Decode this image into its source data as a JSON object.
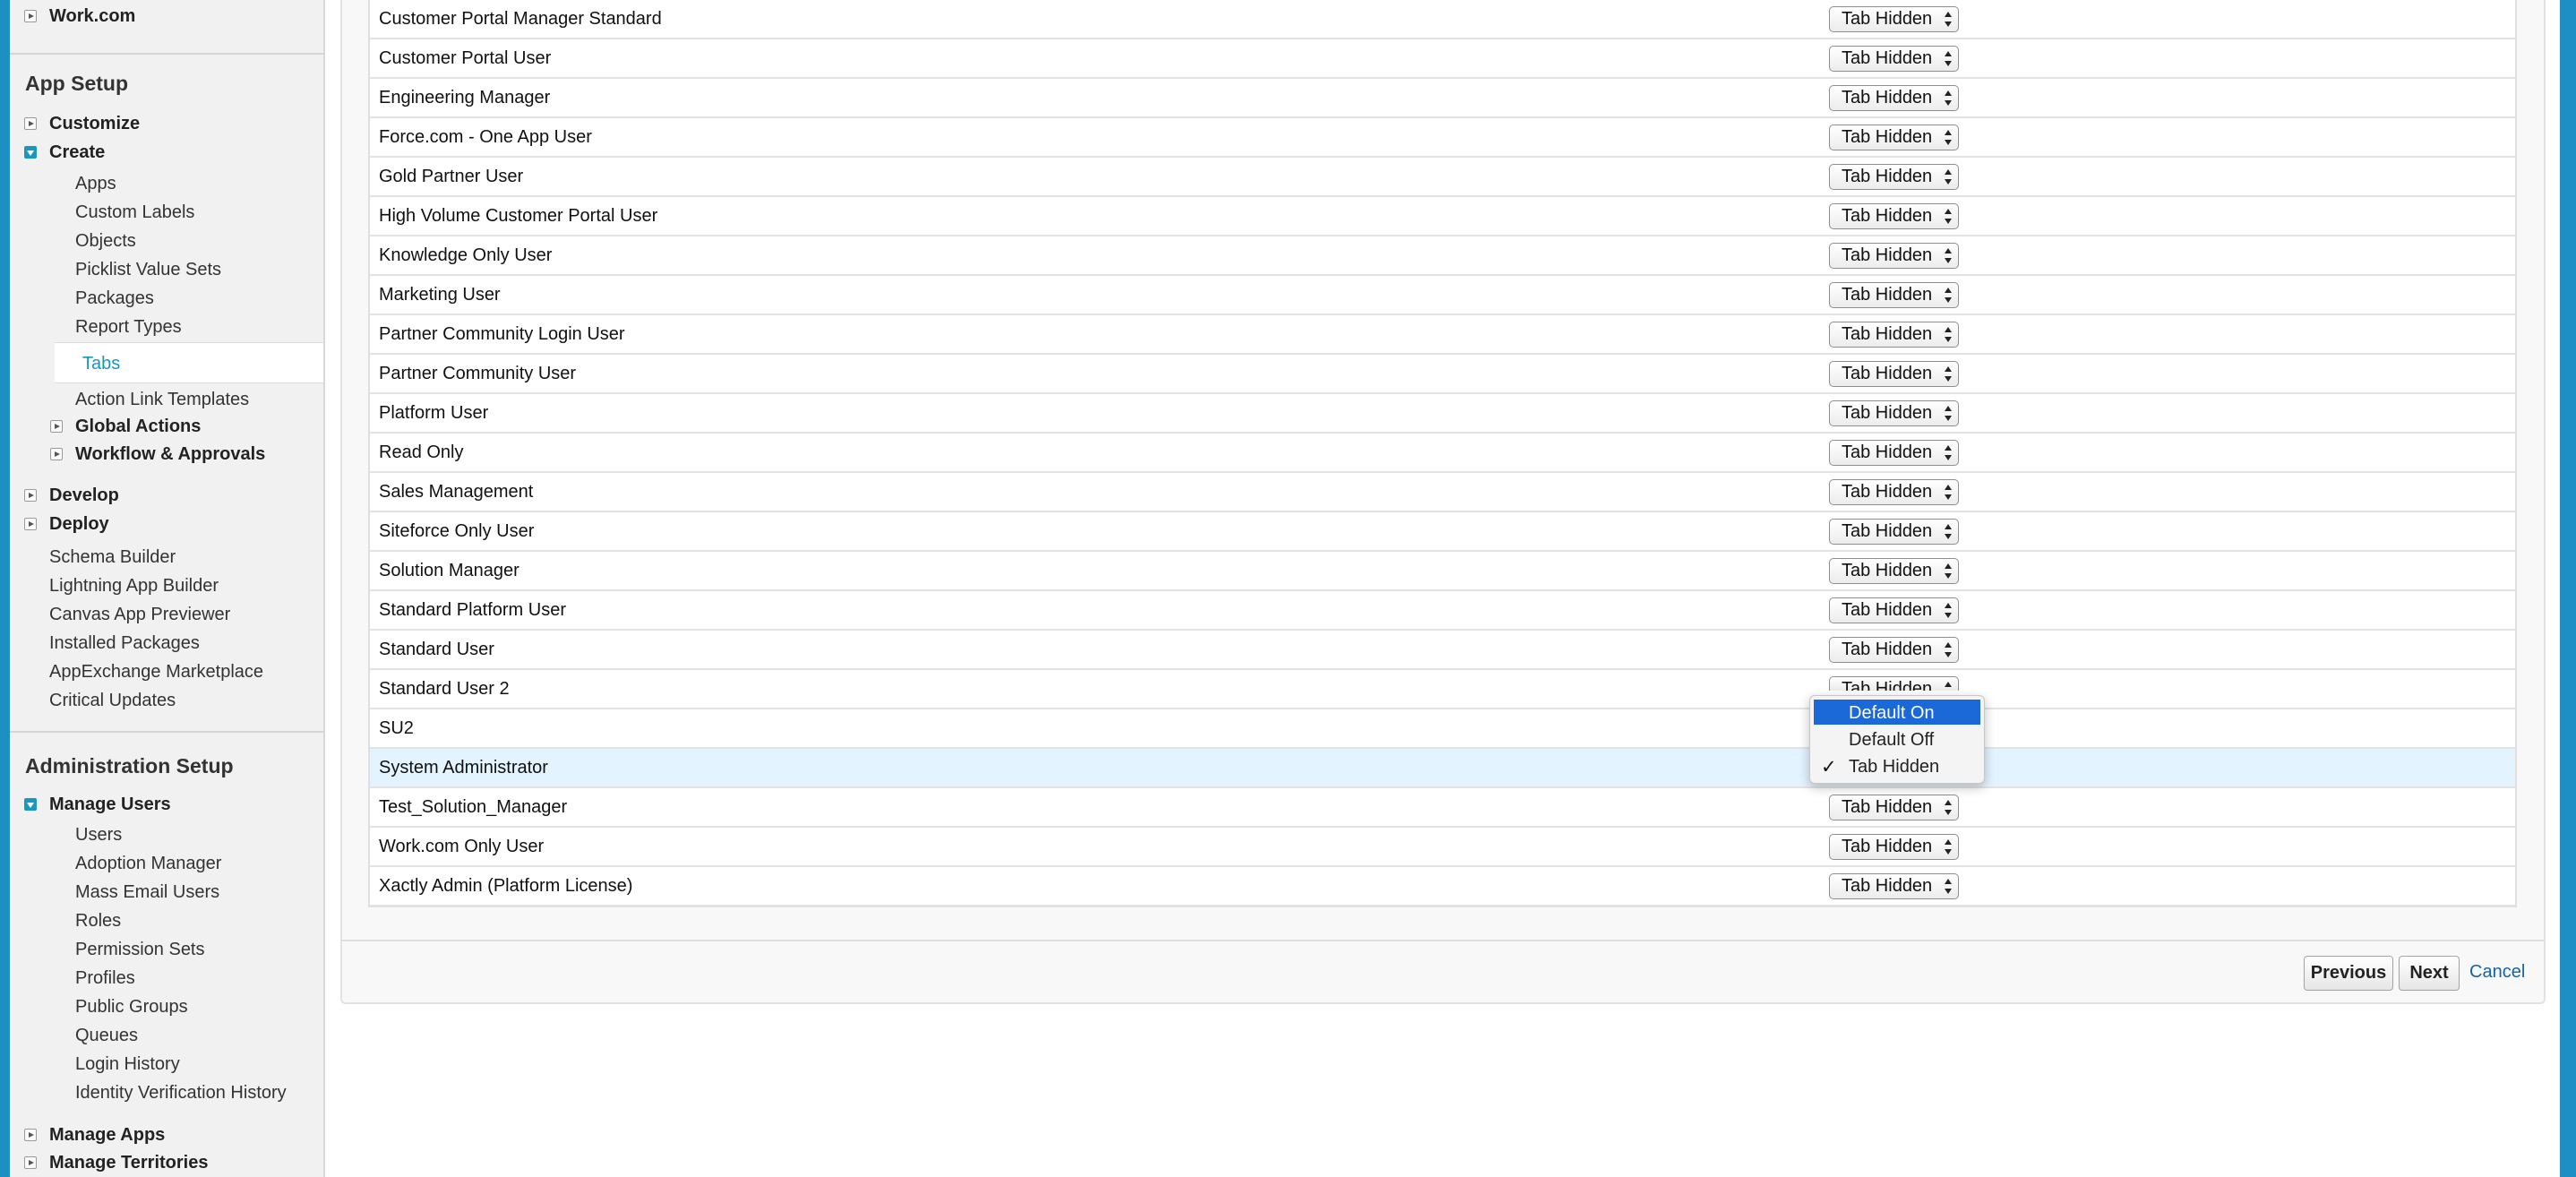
{
  "sidebar": {
    "top_item": "Work.com",
    "app_setup": {
      "heading": "App Setup",
      "customize": "Customize",
      "create": "Create",
      "create_children": [
        "Apps",
        "Custom Labels",
        "Objects",
        "Picklist Value Sets",
        "Packages",
        "Report Types"
      ],
      "selected": "Tabs",
      "action_link_templates": "Action Link Templates",
      "global_actions": "Global Actions",
      "workflow_approvals": "Workflow & Approvals",
      "develop": "Develop",
      "deploy": "Deploy",
      "tools": [
        "Schema Builder",
        "Lightning App Builder",
        "Canvas App Previewer",
        "Installed Packages",
        "AppExchange Marketplace",
        "Critical Updates"
      ]
    },
    "admin_setup": {
      "heading": "Administration Setup",
      "manage_users": "Manage Users",
      "manage_users_children": [
        "Users",
        "Adoption Manager",
        "Mass Email Users",
        "Roles",
        "Permission Sets",
        "Profiles",
        "Public Groups",
        "Queues",
        "Login History",
        "Identity Verification History"
      ],
      "manage_apps": "Manage Apps",
      "manage_territories": "Manage Territories"
    }
  },
  "profiles": [
    {
      "name": "Customer Portal Manager Standard",
      "setting": "Tab Hidden"
    },
    {
      "name": "Customer Portal User",
      "setting": "Tab Hidden"
    },
    {
      "name": "Engineering Manager",
      "setting": "Tab Hidden"
    },
    {
      "name": "Force.com - One App User",
      "setting": "Tab Hidden"
    },
    {
      "name": "Gold Partner User",
      "setting": "Tab Hidden"
    },
    {
      "name": "High Volume Customer Portal User",
      "setting": "Tab Hidden"
    },
    {
      "name": "Knowledge Only User",
      "setting": "Tab Hidden"
    },
    {
      "name": "Marketing User",
      "setting": "Tab Hidden"
    },
    {
      "name": "Partner Community Login User",
      "setting": "Tab Hidden"
    },
    {
      "name": "Partner Community User",
      "setting": "Tab Hidden"
    },
    {
      "name": "Platform User",
      "setting": "Tab Hidden"
    },
    {
      "name": "Read Only",
      "setting": "Tab Hidden"
    },
    {
      "name": "Sales Management",
      "setting": "Tab Hidden"
    },
    {
      "name": "Siteforce Only User",
      "setting": "Tab Hidden"
    },
    {
      "name": "Solution Manager",
      "setting": "Tab Hidden"
    },
    {
      "name": "Standard Platform User",
      "setting": "Tab Hidden"
    },
    {
      "name": "Standard User",
      "setting": "Tab Hidden"
    },
    {
      "name": "Standard User 2",
      "setting": "Tab Hidden"
    },
    {
      "name": "SU2",
      "setting": ""
    },
    {
      "name": "System Administrator",
      "setting": ""
    },
    {
      "name": "Test_Solution_Manager",
      "setting": "Tab Hidden"
    },
    {
      "name": "Work.com Only User",
      "setting": "Tab Hidden"
    },
    {
      "name": "Xactly Admin (Platform License)",
      "setting": "Tab Hidden"
    }
  ],
  "dropdown": {
    "options": [
      "Default On",
      "Default Off",
      "Tab Hidden"
    ],
    "highlighted": "Default On",
    "checked": "Tab Hidden",
    "check_glyph": "✓"
  },
  "footer": {
    "previous": "Previous",
    "next": "Next",
    "cancel": "Cancel"
  }
}
